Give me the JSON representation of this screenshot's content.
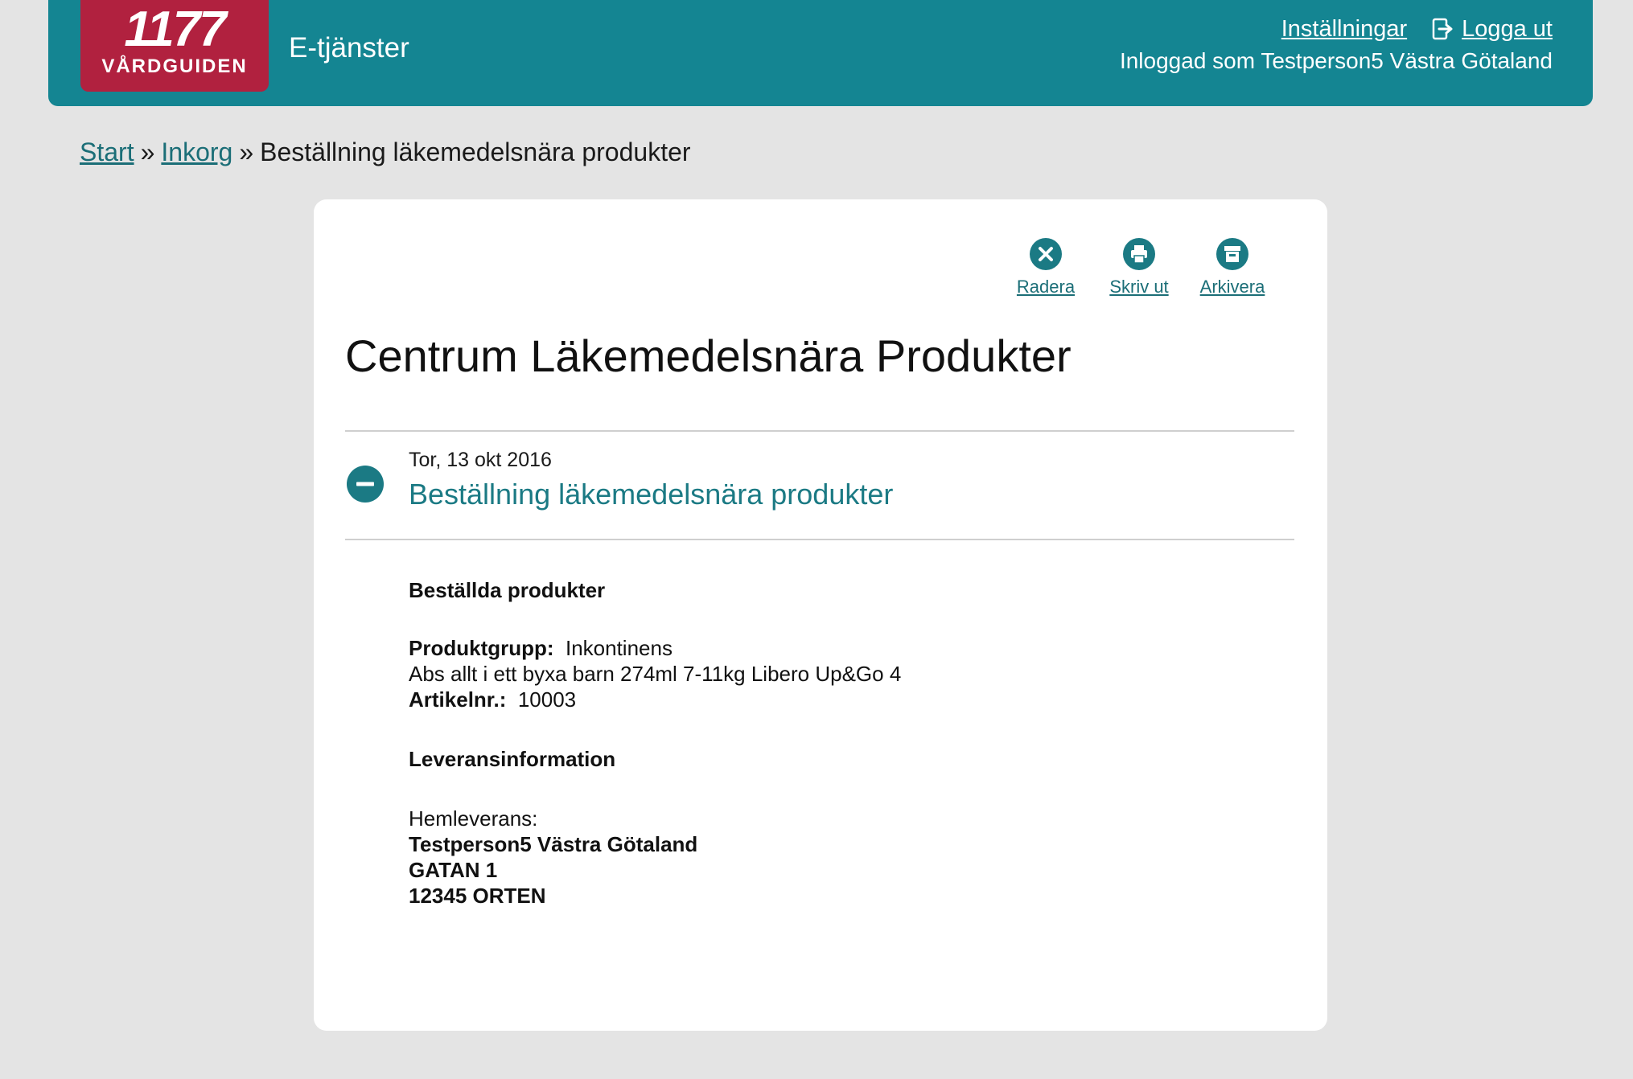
{
  "header": {
    "logo_number": "1177",
    "logo_text": "VÅRDGUIDEN",
    "service_name": "E-tjänster",
    "settings_label": "Inställningar",
    "logout_label": "Logga ut",
    "logged_in_as": "Inloggad som Testperson5 Västra Götaland"
  },
  "breadcrumb": {
    "items": [
      "Start",
      "Inkorg"
    ],
    "separator": "»",
    "current": "Beställning läkemedelsnära produkter"
  },
  "actions": {
    "delete_label": "Radera",
    "print_label": "Skriv ut",
    "archive_label": "Arkivera"
  },
  "page": {
    "title": "Centrum Läkemedelsnära Produkter"
  },
  "message": {
    "date": "Tor, 13 okt 2016",
    "subject": "Beställning läkemedelsnära produkter",
    "ordered_heading": "Beställda produkter",
    "product_group_label": "Produktgrupp:",
    "product_group_value": "Inkontinens",
    "product_name": "Abs allt i ett byxa barn 274ml 7-11kg Libero Up&Go 4",
    "article_label": "Artikelnr.:",
    "article_value": "10003",
    "delivery_heading": "Leveransinformation",
    "delivery_type": "Hemleverans:",
    "recipient_name": "Testperson5 Västra Götaland",
    "street": "GATAN 1",
    "postal": "12345 ORTEN"
  },
  "colors": {
    "header_bg": "#148592",
    "logo_bg": "#b1213f",
    "accent": "#1b7a84",
    "page_bg": "#e4e4e4"
  },
  "icons": [
    "logout-icon",
    "delete-icon",
    "print-icon",
    "archive-icon",
    "collapse-icon"
  ]
}
